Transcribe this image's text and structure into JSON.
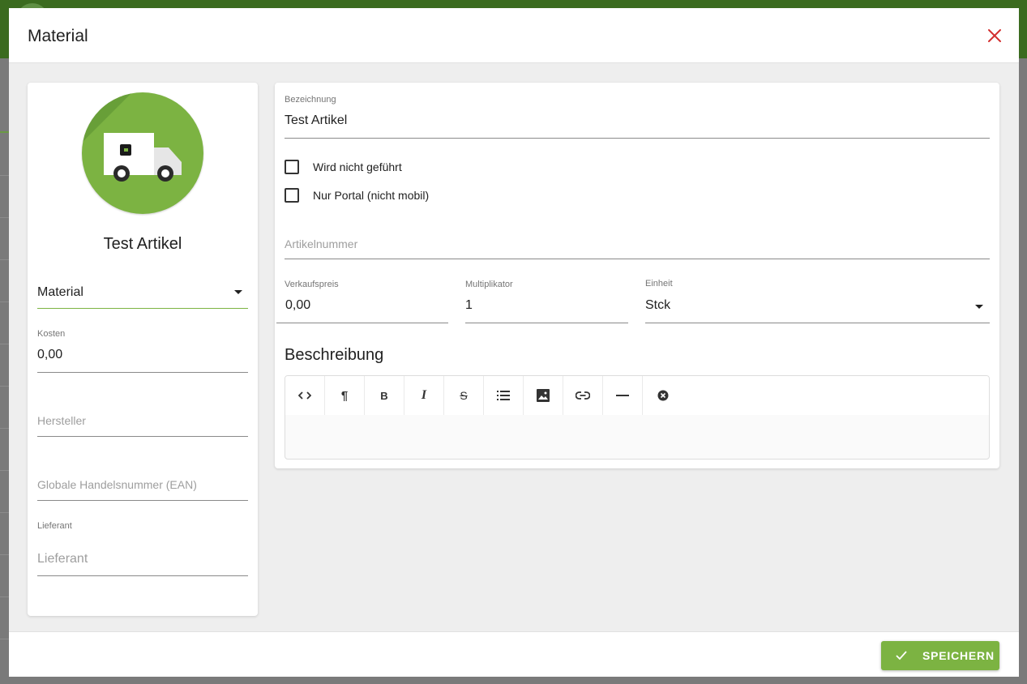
{
  "modal": {
    "title": "Material",
    "save_label": "SPEICHERN"
  },
  "left_card": {
    "item_name": "Test Artikel",
    "type_select": {
      "value": "Material"
    },
    "kosten": {
      "label": "Kosten",
      "value": "0,00"
    },
    "hersteller": {
      "placeholder": "Hersteller"
    },
    "ean": {
      "placeholder": "Globale Handelsnummer (EAN)"
    },
    "lieferant": {
      "label": "Lieferant",
      "placeholder": "Lieferant"
    }
  },
  "right_card": {
    "bezeichnung": {
      "label": "Bezeichnung",
      "value": "Test Artikel"
    },
    "checkboxes": [
      {
        "label": "Wird nicht geführt",
        "checked": false
      },
      {
        "label": "Nur Portal (nicht mobil)",
        "checked": false
      }
    ],
    "artikelnummer": {
      "placeholder": "Artikelnummer"
    },
    "verkaufspreis": {
      "label": "Verkaufspreis",
      "value": "0,00"
    },
    "multiplikator": {
      "label": "Multiplikator",
      "value": "1"
    },
    "einheit": {
      "label": "Einheit",
      "value": "Stck"
    },
    "beschreibung_title": "Beschreibung",
    "editor_tools": [
      {
        "name": "code-icon",
        "glyph": "<>"
      },
      {
        "name": "paragraph-icon",
        "glyph": "¶"
      },
      {
        "name": "bold-icon",
        "glyph": "B"
      },
      {
        "name": "italic-icon",
        "glyph": "I"
      },
      {
        "name": "strikethrough-icon",
        "glyph": "S"
      },
      {
        "name": "list-icon",
        "glyph": "≡"
      },
      {
        "name": "image-icon",
        "glyph": "▣"
      },
      {
        "name": "link-icon",
        "glyph": "∞"
      },
      {
        "name": "horizontal-rule-icon",
        "glyph": "—"
      },
      {
        "name": "clear-format-icon",
        "glyph": "⊗"
      }
    ]
  },
  "colors": {
    "accent": "#7cb342",
    "close": "#d32f2f",
    "topbar": "#3b6b1f"
  }
}
